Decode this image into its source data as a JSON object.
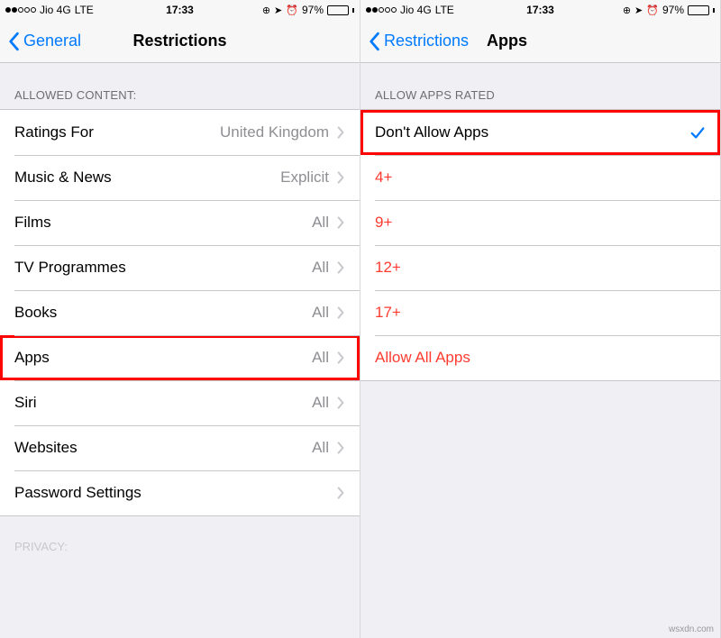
{
  "status": {
    "carrier": "Jio 4G",
    "network": "LTE",
    "time": "17:33",
    "battery_pct": "97%"
  },
  "left": {
    "back_label": "General",
    "title": "Restrictions",
    "section_header": "ALLOWED CONTENT:",
    "rows": [
      {
        "label": "Ratings For",
        "value": "United Kingdom"
      },
      {
        "label": "Music & News",
        "value": "Explicit"
      },
      {
        "label": "Films",
        "value": "All"
      },
      {
        "label": "TV Programmes",
        "value": "All"
      },
      {
        "label": "Books",
        "value": "All"
      },
      {
        "label": "Apps",
        "value": "All"
      },
      {
        "label": "Siri",
        "value": "All"
      },
      {
        "label": "Websites",
        "value": "All"
      },
      {
        "label": "Password Settings",
        "value": ""
      }
    ],
    "privacy_label": "PRIVACY:"
  },
  "right": {
    "back_label": "Restrictions",
    "title": "Apps",
    "section_header": "ALLOW APPS RATED",
    "rows": [
      {
        "label": "Don't Allow Apps",
        "red": false,
        "checked": true
      },
      {
        "label": "4+",
        "red": true,
        "checked": false
      },
      {
        "label": "9+",
        "red": true,
        "checked": false
      },
      {
        "label": "12+",
        "red": true,
        "checked": false
      },
      {
        "label": "17+",
        "red": true,
        "checked": false
      },
      {
        "label": "Allow All Apps",
        "red": true,
        "checked": false
      }
    ]
  },
  "watermark": "wsxdn.com"
}
